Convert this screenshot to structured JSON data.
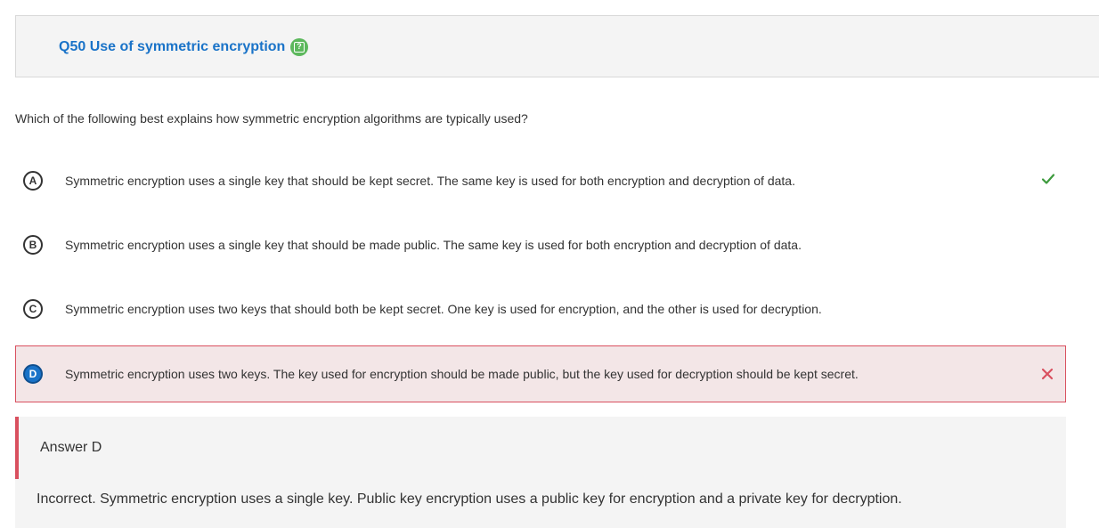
{
  "question": {
    "title": "Q50 Use of symmetric encryption",
    "help_icon": "help-question-icon",
    "prompt": "Which of the following best explains how symmetric encryption algorithms are typically used?"
  },
  "options": [
    {
      "letter": "A",
      "text": "Symmetric encryption uses a single key that should be kept secret. The same key is used for both encryption and decryption of data.",
      "status": "correct",
      "status_icon": "check-icon"
    },
    {
      "letter": "B",
      "text": "Symmetric encryption uses a single key that should be made public. The same key is used for both encryption and decryption of data.",
      "status": "none"
    },
    {
      "letter": "C",
      "text": "Symmetric encryption uses two keys that should both be kept secret. One key is used for encryption, and the other is used for decryption.",
      "status": "none"
    },
    {
      "letter": "D",
      "text": "Symmetric encryption uses two keys. The key used for encryption should be made public, but the key used for decryption should be kept secret.",
      "status": "selected-incorrect",
      "status_icon": "x-icon"
    }
  ],
  "feedback": {
    "answer_label": "Answer D",
    "explanation": "Incorrect. Symmetric encryption uses a single key. Public key encryption uses a public key for encryption and a private key for decryption."
  },
  "colors": {
    "title_blue": "#1a73c8",
    "help_green": "#5cb85c",
    "correct_green": "#3c9a3c",
    "incorrect_red": "#d9505f",
    "incorrect_bg": "#f3e6e7",
    "panel_gray": "#f4f4f4"
  }
}
